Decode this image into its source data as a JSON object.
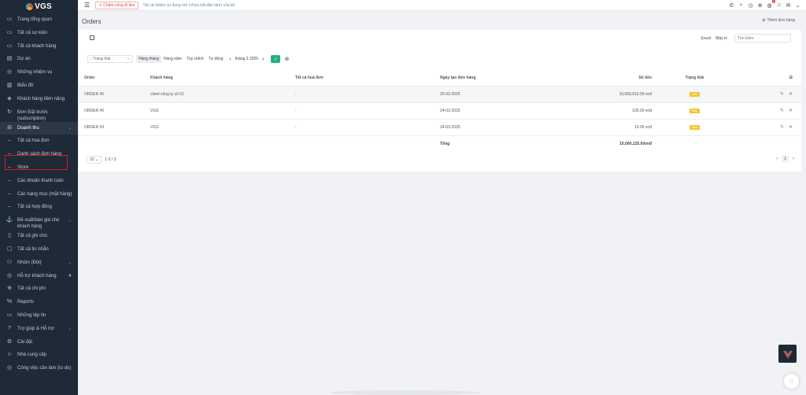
{
  "brand": {
    "logo_text": "VGS"
  },
  "sidebar": {
    "items": [
      {
        "icon": "monitor-icon",
        "glyph": "▭",
        "label": "Trang tổng quan"
      },
      {
        "icon": "monitor-icon",
        "glyph": "▭",
        "label": "Tất cả sự kiện"
      },
      {
        "icon": "monitor-icon",
        "glyph": "▭",
        "label": "Tất cả khách hàng"
      },
      {
        "icon": "briefcase-icon",
        "glyph": "▤",
        "label": "Dự án"
      },
      {
        "icon": "check-circle-icon",
        "glyph": "◎",
        "label": "Những nhiệm vụ"
      },
      {
        "icon": "chart-icon",
        "glyph": "▥",
        "label": "Biểu đồ"
      },
      {
        "icon": "layers-icon",
        "glyph": "◈",
        "label": "Khách hàng tiềm năng"
      },
      {
        "icon": "refresh-icon",
        "glyph": "↻",
        "label": "Đơn Đặt trước (subscription)"
      },
      {
        "icon": "cart-icon",
        "glyph": "⊞",
        "label": "Doanh thu",
        "active": true,
        "chevron": true
      },
      {
        "sub": true,
        "label": "Tất cả hoá đơn"
      },
      {
        "sub": true,
        "label": "Danh sách đơn hàng"
      },
      {
        "sub": true,
        "label": "Store"
      },
      {
        "sub": true,
        "label": "Các khoản thanh toán"
      },
      {
        "sub": true,
        "label": "Các hạng mục (mặt hàng)"
      },
      {
        "sub": true,
        "label": "Tất cả hợp đồng"
      },
      {
        "icon": "anchor-icon",
        "glyph": "⚓",
        "label": "Đề xuất/báo giá cho khách hàng",
        "chevron": true
      },
      {
        "icon": "notebook-icon",
        "glyph": "▯",
        "label": "Tất cả ghi chú"
      },
      {
        "icon": "message-icon",
        "glyph": "▢",
        "label": "Tất cả tin nhắn"
      },
      {
        "icon": "users-icon",
        "glyph": "⚇",
        "label": "Nhóm (Đội)",
        "chevron": true
      },
      {
        "icon": "lifebuoy-icon",
        "glyph": "◎",
        "label": "Hỗ trợ khách hàng",
        "badge": "4"
      },
      {
        "icon": "arrow-circle-icon",
        "glyph": "⊕",
        "label": "Tất cả chi phí"
      },
      {
        "icon": "percent-icon",
        "glyph": "%",
        "label": "Reports"
      },
      {
        "icon": "file-icon",
        "glyph": "▭",
        "label": "Những tệp tin"
      },
      {
        "icon": "help-icon",
        "glyph": "?",
        "label": "Trợ giúp & Hỗ trợ",
        "chevron": true
      },
      {
        "icon": "settings-icon",
        "glyph": "⚙",
        "label": "Cài đặt"
      },
      {
        "icon": "user-icon",
        "glyph": "☺",
        "label": "Nhà cung cấp"
      },
      {
        "icon": "check-circle-icon",
        "glyph": "◎",
        "label": "Công việc cần làm (to do)"
      }
    ]
  },
  "topbar": {
    "clock_in": "Chấm công đi làm",
    "notice": "Tất cả nhiệm vụ đang mở (chưa bắt đầu làm) của tôi",
    "notification_count": "3"
  },
  "page": {
    "title": "Orders",
    "add_order": "Thêm đơn hàng"
  },
  "toolbar": {
    "excel": "Excel",
    "print": "Máy in",
    "search_placeholder": "Tìm kiếm"
  },
  "filters": {
    "status_placeholder": "- Trạng thái -",
    "periods": [
      "Hàng tháng",
      "Hàng năm",
      "Tùy chỉnh",
      "Tự động"
    ],
    "active_period": "Hàng tháng",
    "month": "tháng 3 2025"
  },
  "table": {
    "headers": [
      "Order",
      "Khách hàng",
      "Tất cả hoá đơn",
      "Ngày tạo đơn hàng",
      "Số tiền",
      "Trạng thái"
    ],
    "rows": [
      {
        "order": "ORDER #6",
        "customer": "client công ty số 01",
        "invoices": "-",
        "date": "25-03-2025",
        "amount": "10,000,010.00 vnđ",
        "status": "New"
      },
      {
        "order": "ORDER #5",
        "customer": "VGS",
        "invoices": "-",
        "date": "24-03-2025",
        "amount": "105.00 vnđ",
        "status": "New"
      },
      {
        "order": "ORDER #3",
        "customer": "VGS",
        "invoices": "-",
        "date": "24-03-2025",
        "amount": "10.00 vnđ",
        "status": "New"
      }
    ],
    "total_label": "Tổng",
    "total_amount": "10,000,125.00vnđ"
  },
  "pagination": {
    "page_size": "10",
    "range": "1-3 / 3",
    "current_page": "1"
  },
  "colors": {
    "sidebar_bg": "#1f2a38",
    "accent_green": "#23b07c",
    "status_new": "#f4c430",
    "highlight_box": "#d71920"
  }
}
